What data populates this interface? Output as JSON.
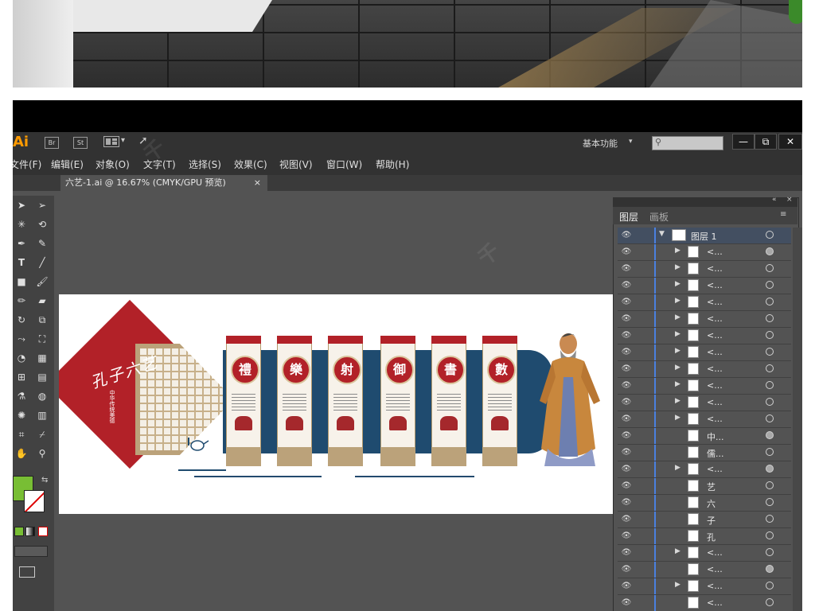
{
  "window": {
    "app_logo": "Ai",
    "bridge_label": "Br",
    "stock_label": "St",
    "workspace": "基本功能",
    "workspace_caret": "▾"
  },
  "menu": [
    "文件(F)",
    "编辑(E)",
    "对象(O)",
    "文字(T)",
    "选择(S)",
    "效果(C)",
    "视图(V)",
    "窗口(W)",
    "帮助(H)"
  ],
  "document_tab": {
    "title": "六艺-1.ai @ 16.67% (CMYK/GPU 预览)",
    "close": "×"
  },
  "window_controls": [
    "—",
    "⧉",
    "✕"
  ],
  "artwork": {
    "title": "孔子六艺",
    "subtitle": "中华传统美德",
    "panels": [
      "禮",
      "樂",
      "射",
      "御",
      "書",
      "數"
    ]
  },
  "layers_panel": {
    "tabs": [
      "图层",
      "画板"
    ],
    "layers": [
      {
        "name": "图层 1",
        "expand": "▼",
        "target_filled": false,
        "top": true
      },
      {
        "name": "<...",
        "expand": "▶",
        "target_filled": true
      },
      {
        "name": "<...",
        "expand": "▶",
        "target_filled": false
      },
      {
        "name": "<...",
        "expand": "▶",
        "target_filled": false
      },
      {
        "name": "<...",
        "expand": "▶",
        "target_filled": false
      },
      {
        "name": "<...",
        "expand": "▶",
        "target_filled": false
      },
      {
        "name": "<...",
        "expand": "▶",
        "target_filled": false
      },
      {
        "name": "<...",
        "expand": "▶",
        "target_filled": false
      },
      {
        "name": "<...",
        "expand": "▶",
        "target_filled": false
      },
      {
        "name": "<...",
        "expand": "▶",
        "target_filled": false
      },
      {
        "name": "<...",
        "expand": "▶",
        "target_filled": false
      },
      {
        "name": "<...",
        "expand": "▶",
        "target_filled": false
      },
      {
        "name": "中...",
        "expand": "",
        "target_filled": true
      },
      {
        "name": "儒...",
        "expand": "",
        "target_filled": false
      },
      {
        "name": "<...",
        "expand": "▶",
        "target_filled": true
      },
      {
        "name": "艺",
        "expand": "",
        "target_filled": false
      },
      {
        "name": "六",
        "expand": "",
        "target_filled": false
      },
      {
        "name": "子",
        "expand": "",
        "target_filled": false
      },
      {
        "name": "孔",
        "expand": "",
        "target_filled": false
      },
      {
        "name": "<...",
        "expand": "▶",
        "target_filled": false
      },
      {
        "name": "<...",
        "expand": "",
        "target_filled": true
      },
      {
        "name": "<...",
        "expand": "▶",
        "target_filled": false
      },
      {
        "name": "<...",
        "expand": "",
        "target_filled": false
      }
    ]
  },
  "colors": {
    "accent_red": "#b22128",
    "navy": "#1f4b6f",
    "tan": "#bba27a",
    "fill_swatch": "#78be34"
  },
  "icons": {
    "eye": "👁",
    "tools": [
      "selection-arrow",
      "direct-selection-arrow",
      "magic-wand",
      "lasso",
      "pen",
      "curvature-pen",
      "type",
      "line",
      "rectangle",
      "paintbrush",
      "pencil",
      "eraser",
      "rotate",
      "scale",
      "width",
      "free-transform",
      "shape-builder",
      "perspective",
      "mesh",
      "gradient",
      "eyedropper",
      "blend",
      "symbol-sprayer",
      "column-graph",
      "artboard",
      "slice",
      "hand",
      "zoom"
    ]
  }
}
